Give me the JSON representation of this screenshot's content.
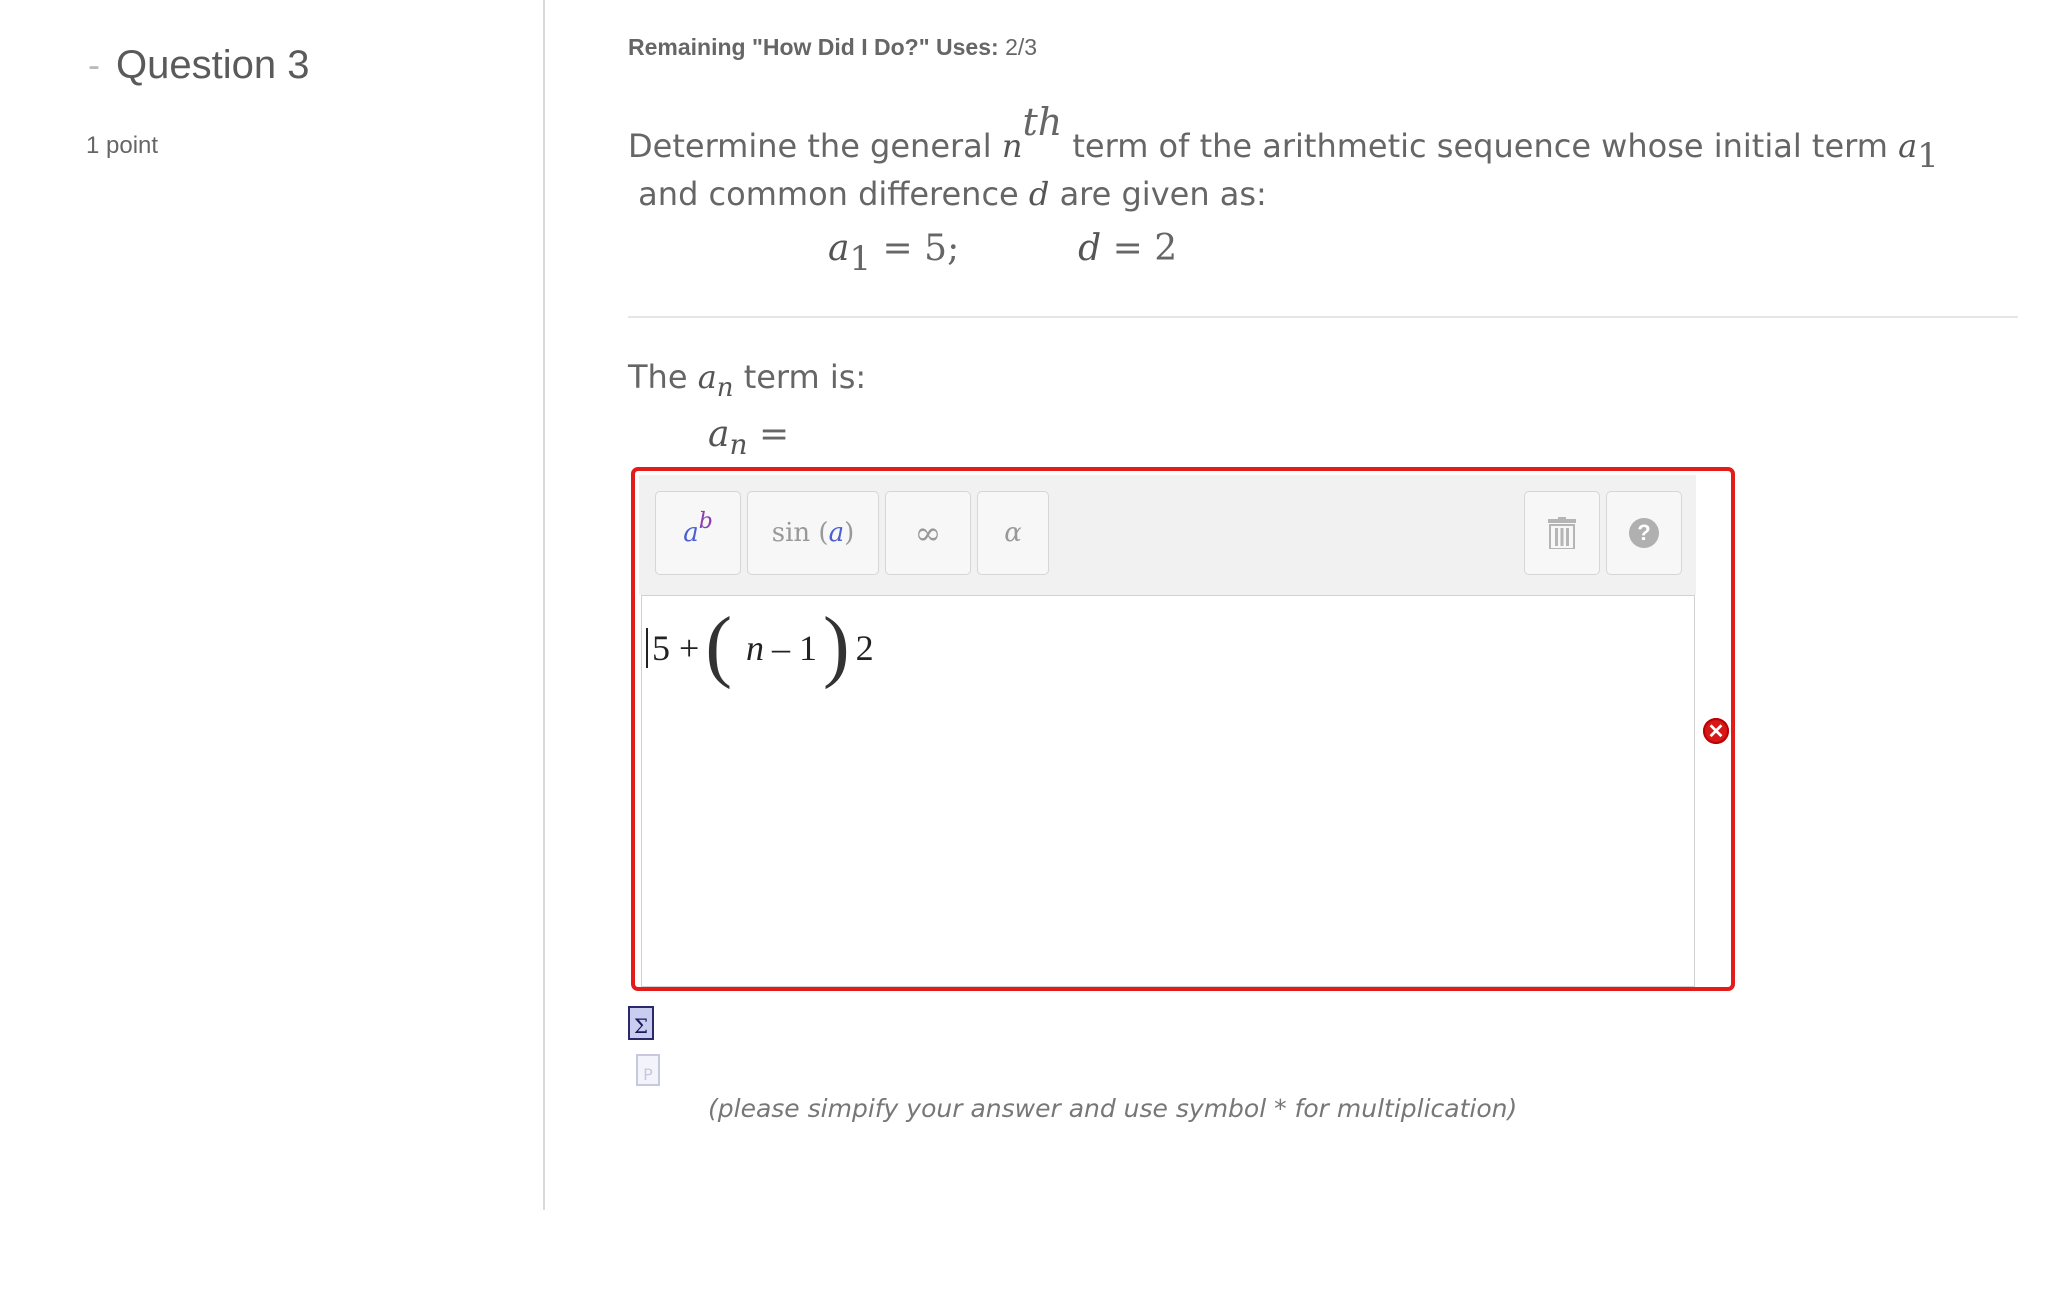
{
  "question": {
    "collapse_symbol": "-",
    "title": "Question 3",
    "points": "1 point"
  },
  "remaining": {
    "label": "Remaining \"How Did I Do?\" Uses:",
    "value": "2/3"
  },
  "prompt": {
    "part1": "Determine the general",
    "n_var": "n",
    "th_sup": "th",
    "part2": "term of the arithmetic sequence whose initial term",
    "a_var": "a",
    "a_sub": "1",
    "part3": "and common difference",
    "d_var": "d",
    "part4": "are given as:"
  },
  "givens": {
    "a1_var": "a",
    "a1_sub": "1",
    "a1_rest": " = 5;",
    "d_var": "d",
    "d_rest": " = 2"
  },
  "answer_label": {
    "prefix": "The",
    "a_var": "a",
    "n_sub": "n",
    "suffix": "term is:"
  },
  "answer_eq": {
    "a_var": "a",
    "n_sub": "n",
    "equals": " ="
  },
  "toolbar": {
    "superscript": {
      "base": "a",
      "exp": "b"
    },
    "function": {
      "prefix": "sin (",
      "arg": "a",
      "suffix": ")"
    },
    "infinity": "∞",
    "greek": "α",
    "trash_icon": "trash-icon",
    "help_icon": "help-icon",
    "help_glyph": "?"
  },
  "editor": {
    "term1": "5 +",
    "lparen": "(",
    "var": "n",
    "minus_one": "– 1",
    "rparen": ")",
    "factor": "2"
  },
  "status": {
    "error_glyph": "✕",
    "error_color": "#d61818"
  },
  "icons": {
    "equation_editor": "Σ",
    "preview": "P"
  },
  "hint": "(please simpify your answer and use symbol * for multiplication)"
}
